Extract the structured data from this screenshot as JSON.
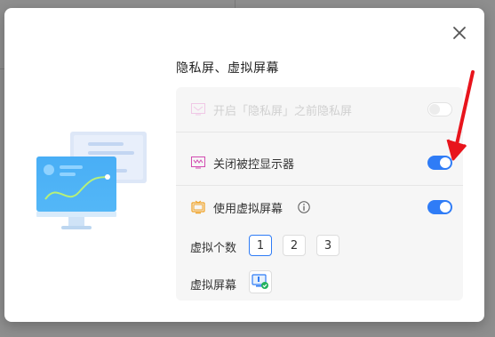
{
  "dialog": {
    "title": "隐私屏、虚拟屏幕",
    "close_icon": "close-icon"
  },
  "privacy_screen": {
    "label": "开启「隐私屏」之前隐私屏",
    "enabled": false,
    "toggle_state": "off"
  },
  "close_monitor": {
    "label": "关闭被控显示器",
    "enabled": true,
    "toggle_state": "on"
  },
  "virtual_screen": {
    "label": "使用虚拟屏幕",
    "enabled": true,
    "toggle_state": "on",
    "count_label": "虚拟个数",
    "counts": [
      "1",
      "2",
      "3"
    ],
    "selected_count": "1",
    "screen_label": "虚拟屏幕"
  },
  "colors": {
    "accent": "#2f7cf6",
    "arrow": "#e8141c",
    "icon_pink": "#d24bb0",
    "icon_orange": "#f0a020"
  }
}
